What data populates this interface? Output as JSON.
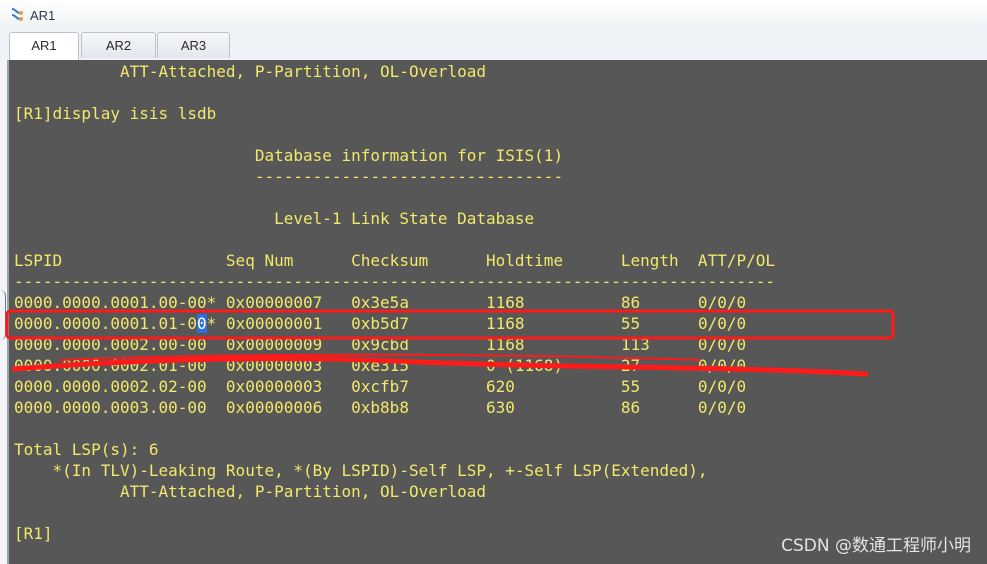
{
  "window": {
    "title": "AR1"
  },
  "tabs": [
    {
      "label": "AR1",
      "active": true
    },
    {
      "label": "AR2",
      "active": false
    },
    {
      "label": "AR3",
      "active": false
    }
  ],
  "terminal": {
    "lines": {
      "l00": "           ATT-Attached, P-Partition, OL-Overload",
      "l01": "",
      "l02": "[R1]display isis lsdb",
      "l03": "",
      "l04": "                         Database information for ISIS(1)",
      "l05": "                         --------------------------------",
      "l06": "",
      "l07": "                           Level-1 Link State Database",
      "l08": "",
      "l09": "LSPID                 Seq Num      Checksum      Holdtime      Length  ATT/P/OL",
      "l10": "-------------------------------------------------------------------------------",
      "l11": "0000.0000.0001.00-00* 0x00000007   0x3e5a        1168          86      0/0/0",
      "l12_pre": "0000.0000.0001.01-0",
      "l12_sel": "0",
      "l12_post": "* 0x00000001   0xb5d7        1168          55      0/0/0",
      "l13": "0000.0000.0002.00-00  0x00000009   0x9cbd        1168          113     0/0/0",
      "l14": "0000.0000.0002.01-00  0x00000003   0xe315        0 (1168)      27      0/0/0",
      "l15": "0000.0000.0002.02-00  0x00000003   0xcfb7        620           55      0/0/0",
      "l16": "0000.0000.0003.00-00  0x00000006   0xb8b8        630           86      0/0/0",
      "l17": "",
      "l18": "Total LSP(s): 6",
      "l19": "    *(In TLV)-Leaking Route, *(By LSPID)-Self LSP, +-Self LSP(Extended),",
      "l20": "           ATT-Attached, P-Partition, OL-Overload",
      "l21": "",
      "l22": "[R1]"
    }
  },
  "watermark": "CSDN @数通工程师小明",
  "colors": {
    "terminal_bg": "#575757",
    "terminal_text": "#f2e86a",
    "annotation": "#ff1a1a"
  }
}
